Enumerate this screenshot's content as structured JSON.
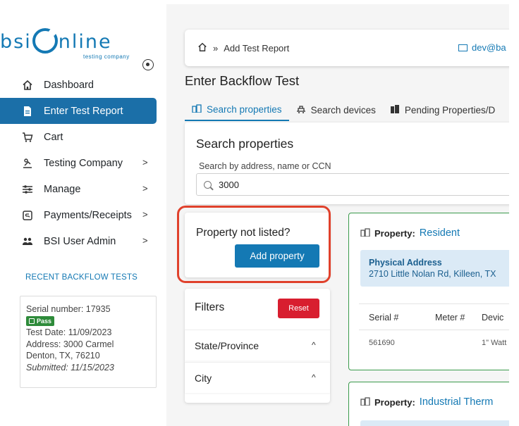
{
  "logo": {
    "text_left": "bsi",
    "text_right": "nline",
    "subtitle": "testing company"
  },
  "nav": [
    {
      "label": "Dashboard",
      "icon": "home-icon",
      "chevron": false
    },
    {
      "label": "Enter Test Report",
      "icon": "document-icon",
      "chevron": false
    },
    {
      "label": "Cart",
      "icon": "cart-icon",
      "chevron": false
    },
    {
      "label": "Testing Company",
      "icon": "company-icon",
      "chevron": true
    },
    {
      "label": "Manage",
      "icon": "sliders-icon",
      "chevron": true
    },
    {
      "label": "Payments/Receipts",
      "icon": "payments-icon",
      "chevron": true
    },
    {
      "label": "BSI User Admin",
      "icon": "users-icon",
      "chevron": true
    }
  ],
  "recent": {
    "title": "RECENT BACKFLOW TESTS",
    "serial_label": "Serial number:",
    "serial": "17935",
    "status": "Pass",
    "test_date_label": "Test Date:",
    "test_date": "11/09/2023",
    "address_label": "Address:",
    "address_line1": "3000 Carmel",
    "address_line2": "Denton, TX, 76210",
    "submitted_label": "Submitted:",
    "submitted": "11/15/2023"
  },
  "breadcrumb": {
    "sep": "»",
    "current": "Add Test Report",
    "email": "dev@ba"
  },
  "page_title": "Enter Backflow Test",
  "tabs": [
    {
      "label": "Search properties",
      "icon": "buildings-icon",
      "active": true
    },
    {
      "label": "Search devices",
      "icon": "device-icon",
      "active": false
    },
    {
      "label": "Pending Properties/D",
      "icon": "pending-icon",
      "active": false
    }
  ],
  "search": {
    "title": "Search properties",
    "label": "Search by address, name or CCN",
    "value": "3000"
  },
  "not_listed": {
    "title": "Property not listed?",
    "button": "Add property"
  },
  "filters": {
    "title": "Filters",
    "reset": "Reset",
    "items": [
      "State/Province",
      "City"
    ]
  },
  "properties": [
    {
      "label": "Property:",
      "name": "Resident",
      "address_label": "Physical Address",
      "address": "2710 Little Nolan Rd, Killeen, TX",
      "columns": [
        "Serial #",
        "Meter #",
        "Devic"
      ],
      "rows": [
        [
          "561690",
          "",
          "1\" Watt"
        ]
      ]
    },
    {
      "label": "Property:",
      "name": "Industrial Therm"
    }
  ],
  "colors": {
    "accent": "#1479b4",
    "active_nav": "#1b6fa8",
    "pass": "#2e8b3a",
    "reset": "#d81e2f",
    "highlight": "#e0412c",
    "card_border": "#3a9a4b"
  }
}
